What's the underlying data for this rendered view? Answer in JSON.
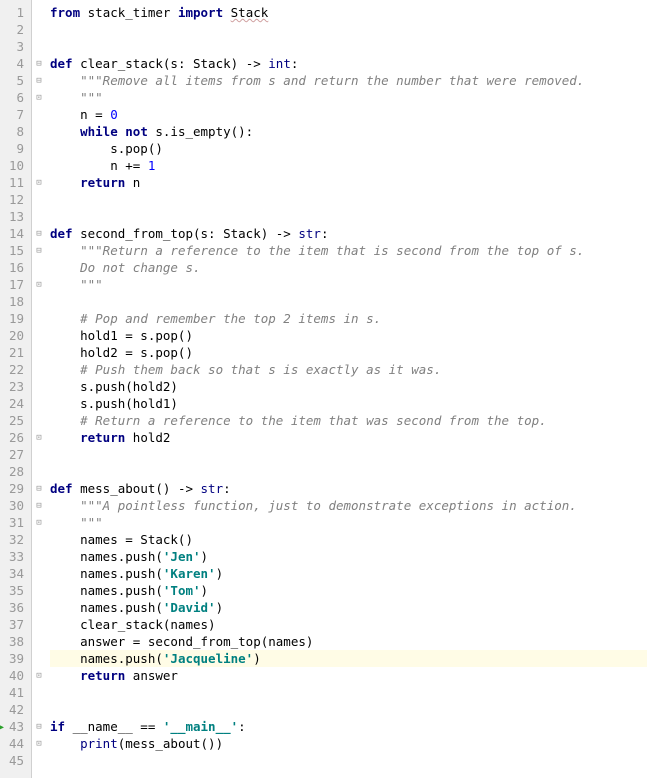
{
  "editor": {
    "total_lines": 45,
    "highlighted_line": 39,
    "arrow_line": 43
  },
  "fold_markers": {
    "4": "open",
    "5": "open",
    "6": "close",
    "11": "close",
    "14": "open",
    "15": "open",
    "17": "close",
    "26": "close",
    "29": "open",
    "30": "open",
    "31": "close",
    "40": "close",
    "43": "open",
    "44": "close"
  },
  "code_lines": {
    "1": [
      {
        "t": "from ",
        "c": "kw"
      },
      {
        "t": "stack_timer ",
        "c": "name"
      },
      {
        "t": "import ",
        "c": "kw"
      },
      {
        "t": "Stack",
        "c": "name wavy"
      }
    ],
    "2": [],
    "3": [],
    "4": [
      {
        "t": "def ",
        "c": "kw"
      },
      {
        "t": "clear_stack",
        "c": "fn"
      },
      {
        "t": "(s: Stack) -> ",
        "c": "name"
      },
      {
        "t": "int",
        "c": "builtin"
      },
      {
        "t": ":",
        "c": "name"
      }
    ],
    "5": [
      {
        "t": "    ",
        "c": ""
      },
      {
        "t": "\"\"\"Remove all items from s and return the number that were removed.",
        "c": "doc"
      }
    ],
    "6": [
      {
        "t": "    ",
        "c": ""
      },
      {
        "t": "\"\"\"",
        "c": "doc"
      }
    ],
    "7": [
      {
        "t": "    n = ",
        "c": "name"
      },
      {
        "t": "0",
        "c": "num"
      }
    ],
    "8": [
      {
        "t": "    ",
        "c": ""
      },
      {
        "t": "while not ",
        "c": "kw"
      },
      {
        "t": "s.is_empty():",
        "c": "name"
      }
    ],
    "9": [
      {
        "t": "        s.pop()",
        "c": "name"
      }
    ],
    "10": [
      {
        "t": "        n += ",
        "c": "name"
      },
      {
        "t": "1",
        "c": "num"
      }
    ],
    "11": [
      {
        "t": "    ",
        "c": ""
      },
      {
        "t": "return ",
        "c": "kw"
      },
      {
        "t": "n",
        "c": "name"
      }
    ],
    "12": [],
    "13": [],
    "14": [
      {
        "t": "def ",
        "c": "kw"
      },
      {
        "t": "second_from_top",
        "c": "fn"
      },
      {
        "t": "(s: Stack) -> ",
        "c": "name"
      },
      {
        "t": "str",
        "c": "builtin"
      },
      {
        "t": ":",
        "c": "name"
      }
    ],
    "15": [
      {
        "t": "    ",
        "c": ""
      },
      {
        "t": "\"\"\"Return a reference to the item that is second from the top of s.",
        "c": "doc"
      }
    ],
    "16": [
      {
        "t": "    ",
        "c": ""
      },
      {
        "t": "Do not change s.",
        "c": "doc"
      }
    ],
    "17": [
      {
        "t": "    ",
        "c": ""
      },
      {
        "t": "\"\"\"",
        "c": "doc"
      }
    ],
    "18": [],
    "19": [
      {
        "t": "    ",
        "c": ""
      },
      {
        "t": "# Pop and remember the top 2 items in s.",
        "c": "com"
      }
    ],
    "20": [
      {
        "t": "    hold1 = s.pop()",
        "c": "name"
      }
    ],
    "21": [
      {
        "t": "    hold2 = s.pop()",
        "c": "name"
      }
    ],
    "22": [
      {
        "t": "    ",
        "c": ""
      },
      {
        "t": "# Push them back so that s is exactly as it was.",
        "c": "com"
      }
    ],
    "23": [
      {
        "t": "    s.push(hold2)",
        "c": "name"
      }
    ],
    "24": [
      {
        "t": "    s.push(hold1)",
        "c": "name"
      }
    ],
    "25": [
      {
        "t": "    ",
        "c": ""
      },
      {
        "t": "# Return a reference to the item that was second from the top.",
        "c": "com"
      }
    ],
    "26": [
      {
        "t": "    ",
        "c": ""
      },
      {
        "t": "return ",
        "c": "kw"
      },
      {
        "t": "hold2",
        "c": "name"
      }
    ],
    "27": [],
    "28": [],
    "29": [
      {
        "t": "def ",
        "c": "kw"
      },
      {
        "t": "mess_about",
        "c": "fn"
      },
      {
        "t": "() -> ",
        "c": "name"
      },
      {
        "t": "str",
        "c": "builtin"
      },
      {
        "t": ":",
        "c": "name"
      }
    ],
    "30": [
      {
        "t": "    ",
        "c": ""
      },
      {
        "t": "\"\"\"A pointless function, just to demonstrate exceptions in action.",
        "c": "doc"
      }
    ],
    "31": [
      {
        "t": "    ",
        "c": ""
      },
      {
        "t": "\"\"\"",
        "c": "doc"
      }
    ],
    "32": [
      {
        "t": "    names = Stack()",
        "c": "name"
      }
    ],
    "33": [
      {
        "t": "    names.push(",
        "c": "name"
      },
      {
        "t": "'Jen'",
        "c": "str"
      },
      {
        "t": ")",
        "c": "name"
      }
    ],
    "34": [
      {
        "t": "    names.push(",
        "c": "name"
      },
      {
        "t": "'Karen'",
        "c": "str"
      },
      {
        "t": ")",
        "c": "name"
      }
    ],
    "35": [
      {
        "t": "    names.push(",
        "c": "name"
      },
      {
        "t": "'Tom'",
        "c": "str"
      },
      {
        "t": ")",
        "c": "name"
      }
    ],
    "36": [
      {
        "t": "    names.push(",
        "c": "name"
      },
      {
        "t": "'David'",
        "c": "str"
      },
      {
        "t": ")",
        "c": "name"
      }
    ],
    "37": [
      {
        "t": "    clear_stack(names)",
        "c": "name"
      }
    ],
    "38": [
      {
        "t": "    answer = second_from_top(names)",
        "c": "name"
      }
    ],
    "39": [
      {
        "t": "    names.push(",
        "c": "name"
      },
      {
        "t": "'Jacqueline'",
        "c": "str"
      },
      {
        "t": ")",
        "c": "name"
      }
    ],
    "40": [
      {
        "t": "    ",
        "c": ""
      },
      {
        "t": "return ",
        "c": "kw"
      },
      {
        "t": "answer",
        "c": "name"
      }
    ],
    "41": [],
    "42": [],
    "43": [
      {
        "t": "if ",
        "c": "kw"
      },
      {
        "t": "__name__ == ",
        "c": "name"
      },
      {
        "t": "'__main__'",
        "c": "str"
      },
      {
        "t": ":",
        "c": "name"
      }
    ],
    "44": [
      {
        "t": "    ",
        "c": ""
      },
      {
        "t": "print",
        "c": "builtin"
      },
      {
        "t": "(mess_about())",
        "c": "name"
      }
    ],
    "45": []
  }
}
